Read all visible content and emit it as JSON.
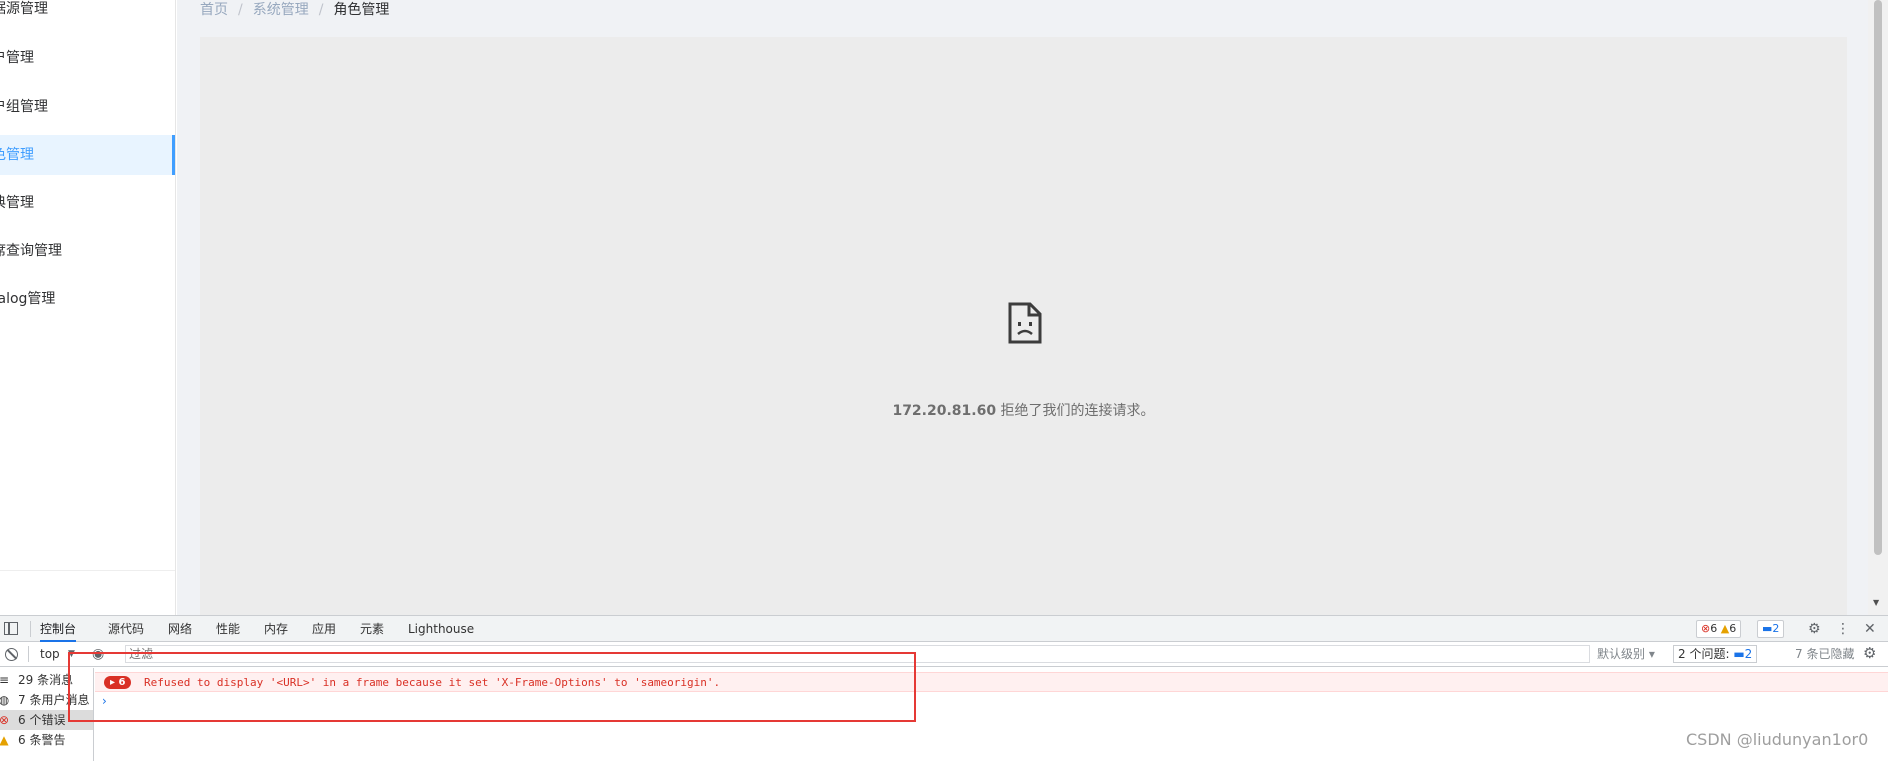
{
  "sidebar": {
    "items": [
      {
        "label": "据源管理",
        "active": false
      },
      {
        "label": "户管理",
        "active": false
      },
      {
        "label": "户组管理",
        "active": false
      },
      {
        "label": "色管理",
        "active": true
      },
      {
        "label": "典管理",
        "active": false
      },
      {
        "label": "席查询管理",
        "active": false
      },
      {
        "label": "talog管理",
        "active": false
      }
    ]
  },
  "breadcrumb": {
    "home": "首页",
    "sep1": "/",
    "section": "系统管理",
    "sep2": "/",
    "current": "角色管理"
  },
  "frame_error": {
    "host": "172.20.81.60",
    "message": "拒绝了我们的连接请求。",
    "icon": "sad-page-icon"
  },
  "devtools": {
    "tabs": [
      {
        "label": "控制台",
        "active": true
      },
      {
        "label": "源代码",
        "active": false
      },
      {
        "label": "网络",
        "active": false
      },
      {
        "label": "性能",
        "active": false
      },
      {
        "label": "内存",
        "active": false
      },
      {
        "label": "应用",
        "active": false
      },
      {
        "label": "元素",
        "active": false
      },
      {
        "label": "Lighthouse",
        "active": false
      }
    ],
    "error_count": "6",
    "warning_count": "6",
    "issue_badge_count": "2",
    "context": "top",
    "filter_placeholder": "过滤",
    "levels_label": "默认级别",
    "issues_label": "2 个问题:",
    "issues_count": "2",
    "hidden_label": "7 条已隐藏",
    "side": [
      {
        "icon": "list-icon",
        "label": "29 条消息"
      },
      {
        "icon": "user-icon",
        "label": "7 条用户消息"
      },
      {
        "icon": "error-icon",
        "label": "6 个错误"
      },
      {
        "icon": "warning-icon",
        "label": "6 条警告"
      }
    ],
    "console_error": {
      "count": "6",
      "message": "Refused to display '<URL>' in a frame because it set 'X-Frame-Options' to 'sameorigin'."
    },
    "prompt": "›"
  },
  "watermark": "CSDN @liudunyan1or0",
  "colors": {
    "accent": "#409eff",
    "error": "#d93025",
    "highlight": "#e53935"
  }
}
